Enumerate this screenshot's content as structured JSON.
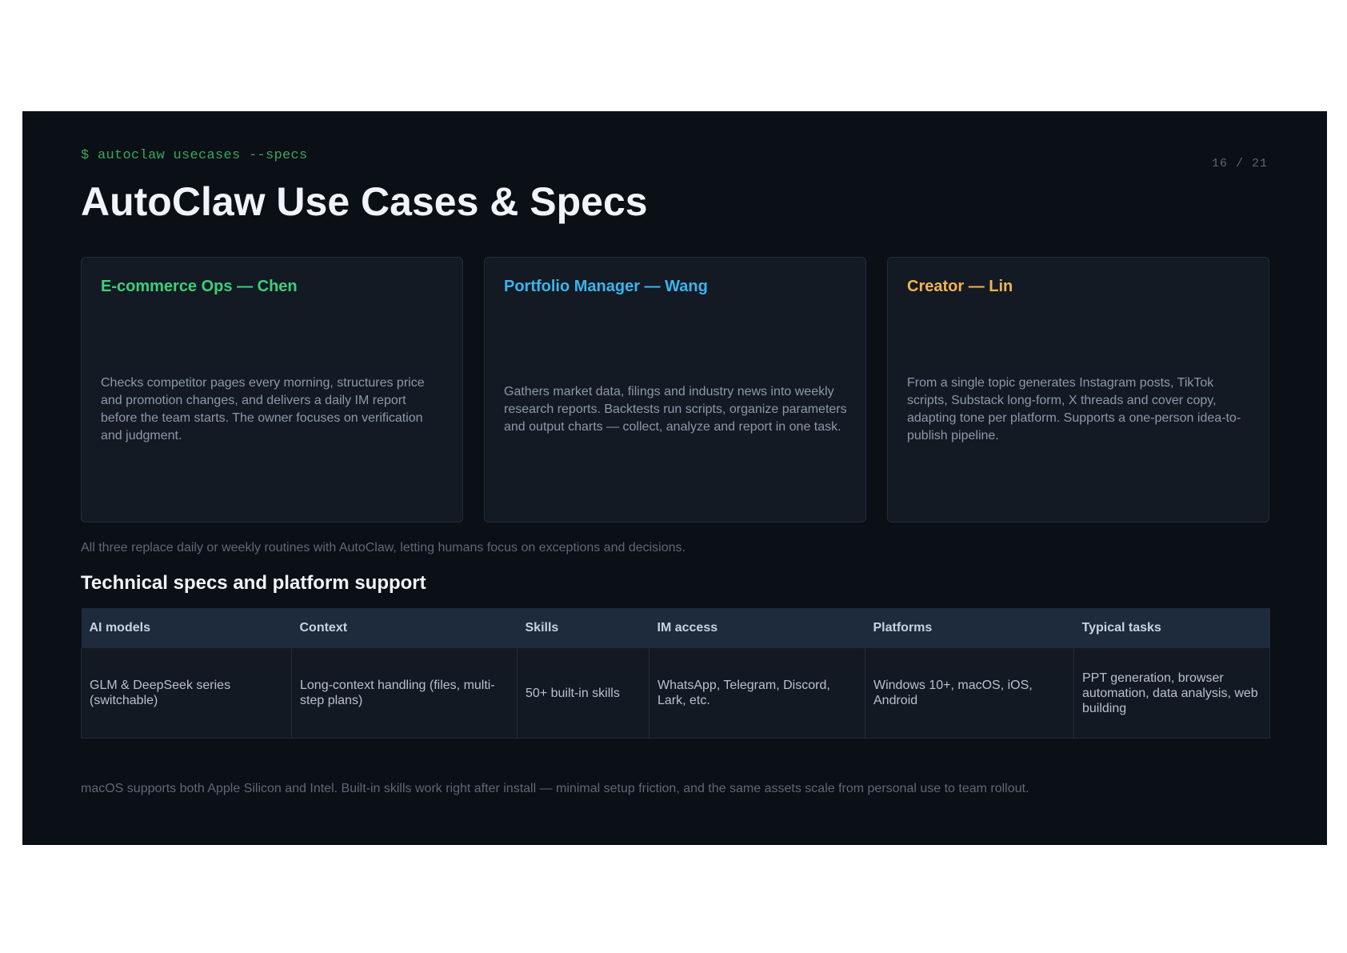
{
  "slide": {
    "prompt": "$ autoclaw usecases --specs",
    "page_number": "16 / 21",
    "title": "AutoClaw Use Cases & Specs"
  },
  "cards": [
    {
      "title": "E-commerce Ops — Chen",
      "color": "#3ecf7a",
      "body": "Checks competitor pages every morning, structures price and promotion changes, and delivers a daily IM report before the team starts. The owner focuses on verification and judgment."
    },
    {
      "title": "Portfolio Manager — Wang",
      "color": "#3cb4ec",
      "body": "Gathers market data, filings and industry news into weekly research reports. Backtests run scripts, organize parameters and output charts — collect, analyze and report in one task."
    },
    {
      "title": "Creator — Lin",
      "color": "#f2b451",
      "body": "From a single topic generates Instagram posts, TikTok scripts, Substack long-form, X threads and cover copy, adapting tone per platform. Supports a one-person idea-to-publish pipeline."
    }
  ],
  "summary": "All three replace daily or weekly routines with AutoClaw, letting humans focus on exceptions and decisions.",
  "specs": {
    "title": "Technical specs and platform support",
    "headers": [
      "AI models",
      "Context",
      "Skills",
      "IM access",
      "Platforms",
      "Typical tasks"
    ],
    "row": [
      "GLM & DeepSeek series (switchable)",
      "Long-context handling (files, multi-step plans)",
      "50+ built-in skills",
      "WhatsApp, Telegram, Discord, Lark, etc.",
      "Windows 10+, macOS, iOS, Android",
      "PPT generation, browser automation, data analysis, web building"
    ]
  },
  "footnote": "macOS supports both Apple Silicon and Intel. Built-in skills work right after install — minimal setup friction, and the same assets scale from personal use to team rollout."
}
